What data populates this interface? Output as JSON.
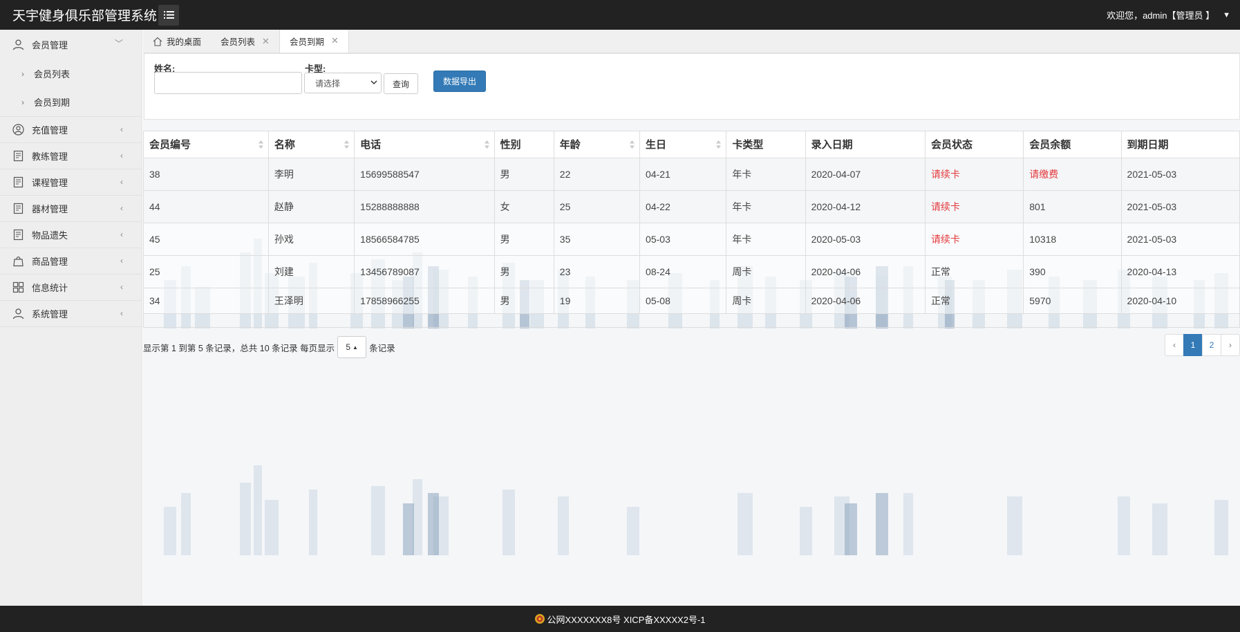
{
  "header": {
    "app_title": "天宇健身俱乐部管理系统",
    "welcome_text": "欢迎您，admin【管理员 】"
  },
  "sidebar": {
    "items": [
      {
        "label": "会员管理",
        "icon": "user-icon",
        "expanded": true
      },
      {
        "label": "充值管理",
        "icon": "user-circle-icon"
      },
      {
        "label": "教练管理",
        "icon": "clipboard-icon"
      },
      {
        "label": "课程管理",
        "icon": "clipboard-icon"
      },
      {
        "label": "器材管理",
        "icon": "clipboard-icon"
      },
      {
        "label": "物品遗失",
        "icon": "clipboard-icon"
      },
      {
        "label": "商品管理",
        "icon": "bag-icon"
      },
      {
        "label": "信息统计",
        "icon": "grid-icon"
      },
      {
        "label": "系统管理",
        "icon": "user-icon"
      }
    ],
    "subitems": [
      {
        "label": "会员列表"
      },
      {
        "label": "会员到期"
      }
    ]
  },
  "tabs": [
    {
      "label": "我的桌面"
    },
    {
      "label": "会员列表"
    },
    {
      "label": "会员到期",
      "active": true
    }
  ],
  "search": {
    "name_label": "姓名:",
    "name_value": "",
    "card_label": "卡型:",
    "card_selected": "请选择",
    "query_label": "查询",
    "export_label": "数据导出"
  },
  "table": {
    "columns": [
      "会员编号",
      "名称",
      "电话",
      "性别",
      "年龄",
      "生日",
      "卡类型",
      "录入日期",
      "会员状态",
      "会员余额",
      "到期日期"
    ],
    "rows": [
      [
        "38",
        "李明",
        "15699588547",
        "男",
        "22",
        "04-21",
        "年卡",
        "2020-04-07",
        "请续卡",
        "请缴费",
        "2021-05-03"
      ],
      [
        "44",
        "赵静",
        "15288888888",
        "女",
        "25",
        "04-22",
        "年卡",
        "2020-04-12",
        "请续卡",
        "801",
        "2021-05-03"
      ],
      [
        "45",
        "孙戏",
        "18566584785",
        "男",
        "35",
        "05-03",
        "年卡",
        "2020-05-03",
        "请续卡",
        "10318",
        "2021-05-03"
      ],
      [
        "25",
        "刘建",
        "13456789087",
        "男",
        "23",
        "08-24",
        "周卡",
        "2020-04-06",
        "正常",
        "390",
        "2020-04-13"
      ],
      [
        "34",
        "王泽明",
        "17858966255",
        "男",
        "19",
        "05-08",
        "周卡",
        "2020-04-06",
        "正常",
        "5970",
        "2020-04-10"
      ]
    ]
  },
  "pagination": {
    "info_prefix": "显示第 1 到第 5 条记录，总共 10 条记录 每页显示",
    "page_size": "5",
    "info_suffix": "条记录",
    "prev": "‹",
    "pages": [
      "1",
      "2"
    ],
    "next": "›",
    "current_page": "1"
  },
  "footer": {
    "text": "公网XXXXXXX8号 XICP备XXXXX2号-1"
  },
  "colors": {
    "header_bg": "#222222",
    "primary": "#337ab7",
    "alert_red": "#e4393c"
  }
}
